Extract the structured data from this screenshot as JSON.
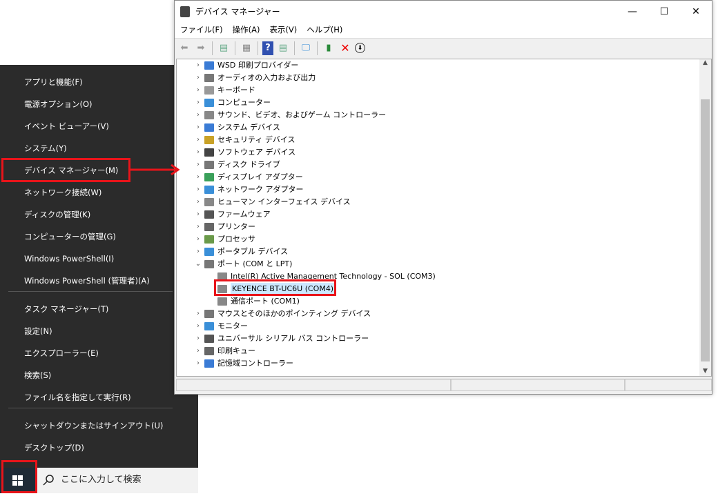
{
  "start_menu": {
    "items": [
      "アプリと機能(F)",
      "電源オプション(O)",
      "イベント ビューアー(V)",
      "システム(Y)",
      "デバイス マネージャー(M)",
      "ネットワーク接続(W)",
      "ディスクの管理(K)",
      "コンピューターの管理(G)",
      "Windows PowerShell(I)",
      "Windows PowerShell (管理者)(A)",
      "タスク マネージャー(T)",
      "設定(N)",
      "エクスプローラー(E)",
      "検索(S)",
      "ファイル名を指定して実行(R)",
      "シャットダウンまたはサインアウト(U)",
      "デスクトップ(D)"
    ],
    "submenu_arrow": "›"
  },
  "taskbar": {
    "search_placeholder": "ここに入力して検索"
  },
  "window": {
    "title": "デバイス マネージャー",
    "controls": [
      "—",
      "☐",
      "✕"
    ],
    "menu": [
      "ファイル(F)",
      "操作(A)",
      "表示(V)",
      "ヘルプ(H)"
    ],
    "tree": [
      {
        "label": "WSD 印刷プロバイダー",
        "color": "#3a7bd5"
      },
      {
        "label": "オーディオの入力および出力",
        "color": "#777"
      },
      {
        "label": "キーボード",
        "color": "#999"
      },
      {
        "label": "コンピューター",
        "color": "#3a8fd8"
      },
      {
        "label": "サウンド、ビデオ、およびゲーム コントローラー",
        "color": "#888"
      },
      {
        "label": "システム デバイス",
        "color": "#3a7bd5"
      },
      {
        "label": "セキュリティ デバイス",
        "color": "#c9a227"
      },
      {
        "label": "ソフトウェア デバイス",
        "color": "#444"
      },
      {
        "label": "ディスク ドライブ",
        "color": "#777"
      },
      {
        "label": "ディスプレイ アダプター",
        "color": "#3aa05a"
      },
      {
        "label": "ネットワーク アダプター",
        "color": "#3a8fd8"
      },
      {
        "label": "ヒューマン インターフェイス デバイス",
        "color": "#888"
      },
      {
        "label": "ファームウェア",
        "color": "#555"
      },
      {
        "label": "プリンター",
        "color": "#666"
      },
      {
        "label": "プロセッサ",
        "color": "#6a9a4a"
      },
      {
        "label": "ポータブル デバイス",
        "color": "#3a8fd8"
      },
      {
        "label": "ポート (COM と LPT)",
        "color": "#777",
        "expanded": true,
        "children": [
          "Intel(R) Active Management Technology - SOL (COM3)",
          "KEYENCE BT-UC6U (COM4)",
          "通信ポート (COM1)"
        ]
      },
      {
        "label": "マウスとそのほかのポインティング デバイス",
        "color": "#777"
      },
      {
        "label": "モニター",
        "color": "#3a8fd8"
      },
      {
        "label": "ユニバーサル シリアル バス コントローラー",
        "color": "#555"
      },
      {
        "label": "印刷キュー",
        "color": "#666"
      },
      {
        "label": "記憶域コントローラー",
        "color": "#3a7bd5"
      }
    ],
    "selected_child": "KEYENCE BT-UC6U (COM4)"
  },
  "accent": "#e8141a"
}
